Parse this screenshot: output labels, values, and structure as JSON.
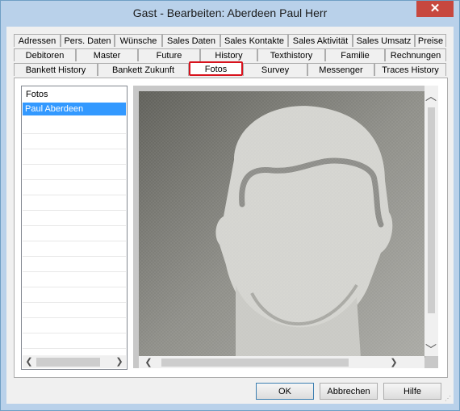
{
  "window": {
    "title": "Gast - Bearbeiten: Aberdeen Paul Herr",
    "close_label": "✕"
  },
  "tabs": {
    "row1": [
      "Adressen",
      "Pers. Daten",
      "Wünsche",
      "Sales Daten",
      "Sales Kontakte",
      "Sales Aktivität",
      "Sales Umsatz",
      "Preise"
    ],
    "row2": [
      "Debitoren",
      "Master",
      "Future",
      "History",
      "Texthistory",
      "Familie",
      "Rechnungen"
    ],
    "row3": [
      "Bankett History",
      "Bankett Zukunft",
      "Fotos",
      "Survey",
      "Messenger",
      "Traces History"
    ],
    "active": "Fotos"
  },
  "photo_list": {
    "header": "Fotos",
    "items": [
      "Paul Aberdeen"
    ],
    "selected": "Paul Aberdeen"
  },
  "buttons": {
    "ok": "OK",
    "cancel": "Abbrechen",
    "help": "Hilfe"
  },
  "colors": {
    "selection": "#3399ff",
    "active_tab_border": "#d8121d",
    "close_button": "#c7483f"
  }
}
